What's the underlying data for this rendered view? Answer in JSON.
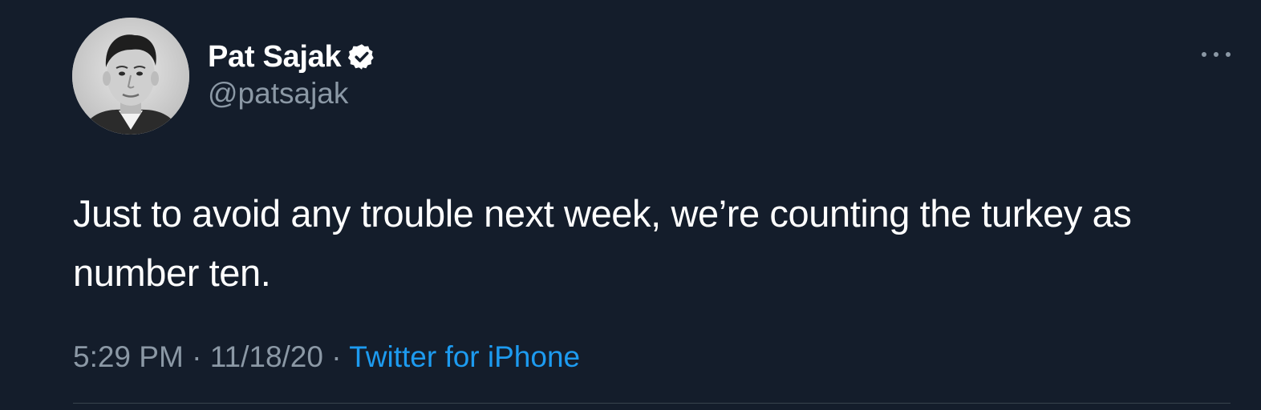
{
  "user": {
    "display_name": "Pat Sajak",
    "handle": "@patsajak",
    "verified": true,
    "avatar_icon": "profile-photo-black-and-white"
  },
  "tweet": {
    "text": "Just to avoid any trouble next week, we’re counting the turkey as number ten.",
    "time": "5:29 PM",
    "separator": "·",
    "date": "11/18/20",
    "source": "Twitter for iPhone"
  },
  "icons": {
    "more": "more-horizontal-icon",
    "verified": "verified-badge-icon"
  },
  "colors": {
    "background": "#141d2b",
    "text_primary": "#ffffff",
    "text_secondary": "#8b98a5",
    "link": "#1d9bf0",
    "divider": "#38444d"
  }
}
